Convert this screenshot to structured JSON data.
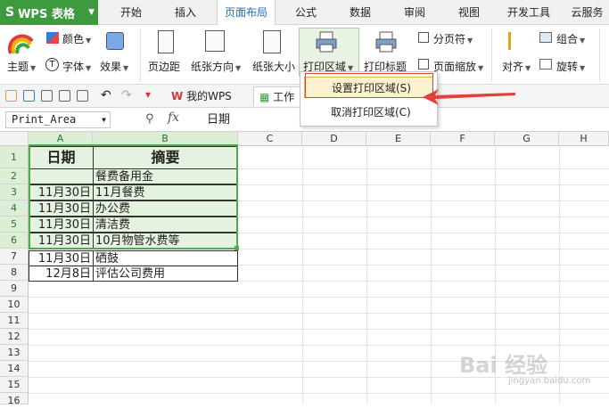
{
  "app": {
    "title": "WPS 表格",
    "logo": "S"
  },
  "menu": [
    "开始",
    "插入",
    "页面布局",
    "公式",
    "数据",
    "审阅",
    "视图",
    "开发工具",
    "云服务"
  ],
  "ribbon": {
    "theme": "主题",
    "color": "颜色",
    "font": "字体",
    "effect": "效果",
    "margin": "页边距",
    "orientation": "纸张方向",
    "size": "纸张大小",
    "print_area": "打印区域",
    "print_titles": "打印标题",
    "page_break": "分页符",
    "page_zoom": "页面缩放",
    "align": "对齐",
    "group": "组合",
    "rotate": "旋转"
  },
  "quick_access": {
    "doc_tab_wps": "我的WPS",
    "doc_tab_work": "工作"
  },
  "formula_bar": {
    "name_box": "Print_Area",
    "fx": "fx",
    "content": "日期"
  },
  "dropdown": {
    "set_print_area": "设置打印区域(S)",
    "clear_print_area": "取消打印区域(C)"
  },
  "columns": [
    "A",
    "B",
    "C",
    "D",
    "E",
    "F",
    "G",
    "H"
  ],
  "rows": [
    "1",
    "2",
    "3",
    "4",
    "5",
    "6",
    "7",
    "8",
    "9",
    "10",
    "11",
    "12",
    "13",
    "14",
    "15",
    "16"
  ],
  "table": {
    "header": [
      "日期",
      "摘要"
    ],
    "rows": [
      [
        "",
        "餐费备用金"
      ],
      [
        "11月30日",
        "11月餐费"
      ],
      [
        "11月30日",
        "办公费"
      ],
      [
        "11月30日",
        "清洁费"
      ],
      [
        "11月30日",
        "10月物管水费等"
      ],
      [
        "11月30日",
        "硒鼓"
      ],
      [
        "12月8日",
        "评估公司费用"
      ]
    ]
  },
  "watermark": {
    "main": "Bai 经验",
    "sub": "jingyan.baidu.com"
  }
}
